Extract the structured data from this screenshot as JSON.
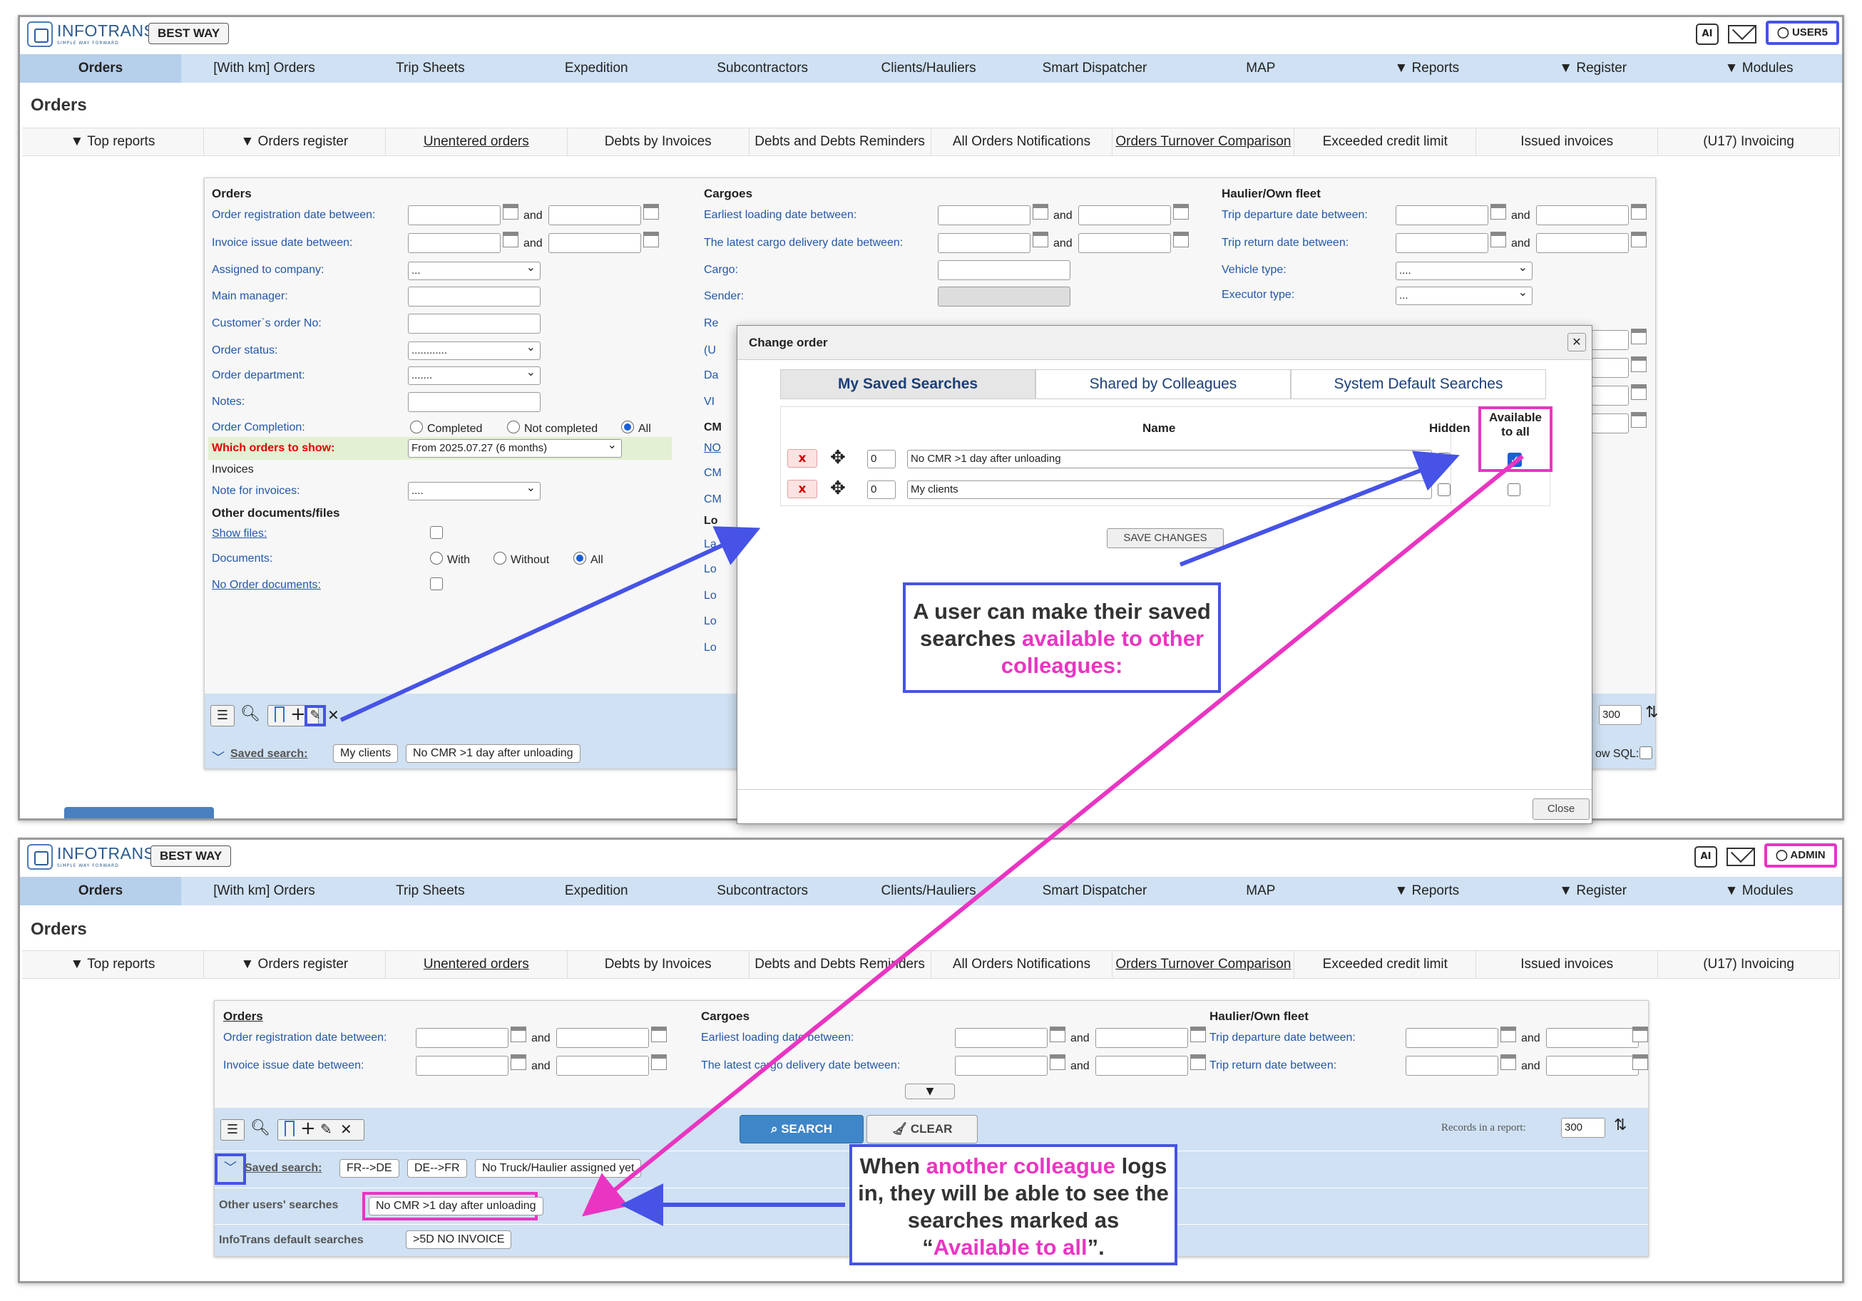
{
  "panel1": {
    "logo": "INFOTRANS",
    "logo_sub": "SIMPLE WAY FORWARD",
    "company": "BEST WAY",
    "ai_icon": "AI",
    "user": "USER5",
    "nav": [
      "Orders",
      "[With km] Orders",
      "Trip Sheets",
      "Expedition",
      "Subcontractors",
      "Clients/Hauliers",
      "Smart Dispatcher",
      "MAP",
      "▼ Reports",
      "▼ Register",
      "▼ Modules"
    ],
    "page_title": "Orders",
    "subnav": [
      "▼ Top reports",
      "▼ Orders register",
      "Unentered orders",
      "Debts by Invoices",
      "Debts and Debts Reminders",
      "All Orders Notifications",
      "Orders Turnover Comparison",
      "Exceeded credit limit",
      "Issued invoices",
      "(U17) Invoicing"
    ],
    "filters": {
      "orders_title": "Orders",
      "order_reg": "Order registration date between:",
      "invoice_issue": "Invoice issue date between:",
      "and": "and",
      "assigned": "Assigned to company:",
      "assigned_val": "...",
      "main_manager": "Main manager:",
      "cust_order": "Customer`s order No:",
      "status": "Order status:",
      "status_val": "............",
      "dept": "Order department:",
      "dept_val": ".......",
      "notes": "Notes:",
      "completion": "Order Completion:",
      "completed": "Completed",
      "not_completed": "Not completed",
      "all": "All",
      "which": "Which orders to show:",
      "which_val": "From 2025.07.27 (6 months)",
      "invoices": "Invoices",
      "note_inv": "Note for invoices:",
      "note_inv_val": "....",
      "other_docs": "Other documents/files",
      "show_files": "Show files:",
      "documents": "Documents:",
      "with": "With",
      "without": "Without",
      "no_order_docs": "No Order documents:",
      "cargoes_title": "Cargoes",
      "earliest": "Earliest loading date between:",
      "latest": "The latest cargo delivery date between:",
      "cargo": "Cargo:",
      "sender": "Sender:",
      "cut_labels": [
        "Re",
        "(U",
        "Da",
        "VI",
        "CM",
        "NO",
        "CM",
        "CM",
        "Lo",
        "La",
        "Lo",
        "Lo",
        "Lo",
        "Lo"
      ],
      "haulier_title": "Haulier/Own fleet",
      "trip_dep": "Trip departure date between:",
      "trip_ret": "Trip return date between:",
      "vehicle": "Vehicle type:",
      "vehicle_val": "....",
      "executor": "Executor type:",
      "executor_val": "...",
      "records_val": "300",
      "show_sql": "ow SQL:",
      "saved_label": "Saved search:",
      "saved_chips": [
        "My clients",
        "No CMR >1 day after unloading"
      ]
    },
    "modal": {
      "title": "Change order",
      "tabs": [
        "My Saved Searches",
        "Shared by Colleagues",
        "System Default Searches"
      ],
      "col_name": "Name",
      "col_hidden": "Hidden",
      "col_available": "Available to all",
      "rows": [
        {
          "order": "0",
          "name": "No CMR >1 day after unloading",
          "hidden": false,
          "available": true
        },
        {
          "order": "0",
          "name": "My clients",
          "hidden": false,
          "available": false
        }
      ],
      "save": "SAVE CHANGES",
      "close": "Close",
      "delete_icon": "x"
    },
    "callout": {
      "part1": "A user can make their saved searches ",
      "part2": "available to other colleagues:"
    }
  },
  "panel2": {
    "logo": "INFOTRANS",
    "logo_sub": "SIMPLE WAY FORWARD",
    "company": "BEST WAY",
    "ai_icon": "AI",
    "user": "ADMIN",
    "nav": [
      "Orders",
      "[With km] Orders",
      "Trip Sheets",
      "Expedition",
      "Subcontractors",
      "Clients/Hauliers",
      "Smart Dispatcher",
      "MAP",
      "▼ Reports",
      "▼ Register",
      "▼ Modules"
    ],
    "page_title": "Orders",
    "subnav": [
      "▼ Top reports",
      "▼ Orders register",
      "Unentered orders",
      "Debts by Invoices",
      "Debts and Debts Reminders",
      "All Orders Notifications",
      "Orders Turnover Comparison",
      "Exceeded credit limit",
      "Issued invoices",
      "(U17) Invoicing"
    ],
    "filters": {
      "orders_title": "Orders",
      "order_reg": "Order registration date between:",
      "invoice_issue": "Invoice issue date between:",
      "and": "and",
      "cargoes_title": "Cargoes",
      "earliest": "Earliest loading date between:",
      "latest": "The latest cargo delivery date between:",
      "haulier_title": "Haulier/Own fleet",
      "trip_dep": "Trip departure date between:",
      "trip_ret": "Trip return date between:",
      "search": "SEARCH",
      "clear": "CLEAR",
      "records_label": "Records in a report:",
      "records_val": "300",
      "saved_label": "Saved search:",
      "saved_chips": [
        "FR-->DE",
        "DE-->FR",
        "No Truck/Haulier assigned yet"
      ],
      "other_label": "Other users' searches",
      "other_chip": "No CMR >1 day after unloading",
      "default_label": "InfoTrans default searches",
      "default_chip": ">5D NO INVOICE"
    },
    "callout": {
      "part1": "When ",
      "part2": "another colleague",
      "part3": " logs in, they will be able to see the searches marked as “",
      "part4": "Available to all",
      "part5": "”."
    }
  },
  "colors": {
    "nav_bg": "#cfe1f3",
    "label_blue": "#2457a6",
    "annot_blue": "#4653e6",
    "annot_pink": "#e935c2",
    "alert_red": "#e00000"
  }
}
